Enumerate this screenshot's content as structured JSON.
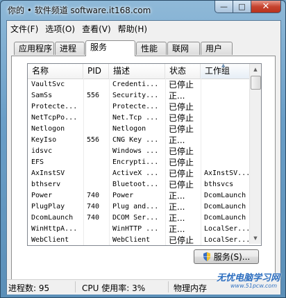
{
  "window": {
    "title": "你的 • 软件频道 software.it168.com"
  },
  "caption": {
    "min": "—",
    "max": "□",
    "close": "✕"
  },
  "menu": {
    "items": [
      "文件(F)",
      "选项(O)",
      "查看(V)",
      "帮助(H)"
    ]
  },
  "tabs": [
    {
      "label": "应用程序",
      "active": false
    },
    {
      "label": "进程",
      "active": false
    },
    {
      "label": "服务",
      "active": true
    },
    {
      "label": "性能",
      "active": false
    },
    {
      "label": "联网",
      "active": false
    },
    {
      "label": "用户",
      "active": false
    }
  ],
  "columns": [
    "名称",
    "PID",
    "描述",
    "状态",
    "工作组"
  ],
  "sorted_column": "工作组",
  "rows": [
    {
      "name": "VaultSvc",
      "pid": "",
      "desc": "Credenti...",
      "status": "已停止",
      "group": ""
    },
    {
      "name": "SamSs",
      "pid": "556",
      "desc": "Security...",
      "status": "正...",
      "group": ""
    },
    {
      "name": "Protecte...",
      "pid": "",
      "desc": "Protecte...",
      "status": "已停止",
      "group": ""
    },
    {
      "name": "NetTcpPo...",
      "pid": "",
      "desc": "Net.Tcp ...",
      "status": "已停止",
      "group": ""
    },
    {
      "name": "Netlogon",
      "pid": "",
      "desc": "Netlogon",
      "status": "已停止",
      "group": ""
    },
    {
      "name": "KeyIso",
      "pid": "556",
      "desc": "CNG Key ...",
      "status": "正...",
      "group": ""
    },
    {
      "name": "idsvc",
      "pid": "",
      "desc": "Windows ...",
      "status": "已停止",
      "group": ""
    },
    {
      "name": "EFS",
      "pid": "",
      "desc": "Encrypti...",
      "status": "已停止",
      "group": ""
    },
    {
      "name": "AxInstSV",
      "pid": "",
      "desc": "ActiveX ...",
      "status": "已停止",
      "group": "AxInstSV..."
    },
    {
      "name": "bthserv",
      "pid": "",
      "desc": "Bluetoot...",
      "status": "已停止",
      "group": "bthsvcs"
    },
    {
      "name": "Power",
      "pid": "740",
      "desc": "Power",
      "status": "正...",
      "group": "DcomLaunch"
    },
    {
      "name": "PlugPlay",
      "pid": "740",
      "desc": "Plug and...",
      "status": "正...",
      "group": "DcomLaunch"
    },
    {
      "name": "DcomLaunch",
      "pid": "740",
      "desc": "DCOM Ser...",
      "status": "正...",
      "group": "DcomLaunch"
    },
    {
      "name": "WinHttpA...",
      "pid": "",
      "desc": "WinHTTP ...",
      "status": "正...",
      "group": "LocalSer..."
    },
    {
      "name": "WebClient",
      "pid": "",
      "desc": "WebClient",
      "status": "已停止",
      "group": "LocalSer..."
    }
  ],
  "services_button": "服务(S)...",
  "status": {
    "processes": "进程数: 95",
    "cpu": "CPU 使用率: 3%",
    "memory": "物理内存"
  },
  "watermark": {
    "text": "无忧电脑学习网",
    "url": "www.51pcw.com"
  }
}
